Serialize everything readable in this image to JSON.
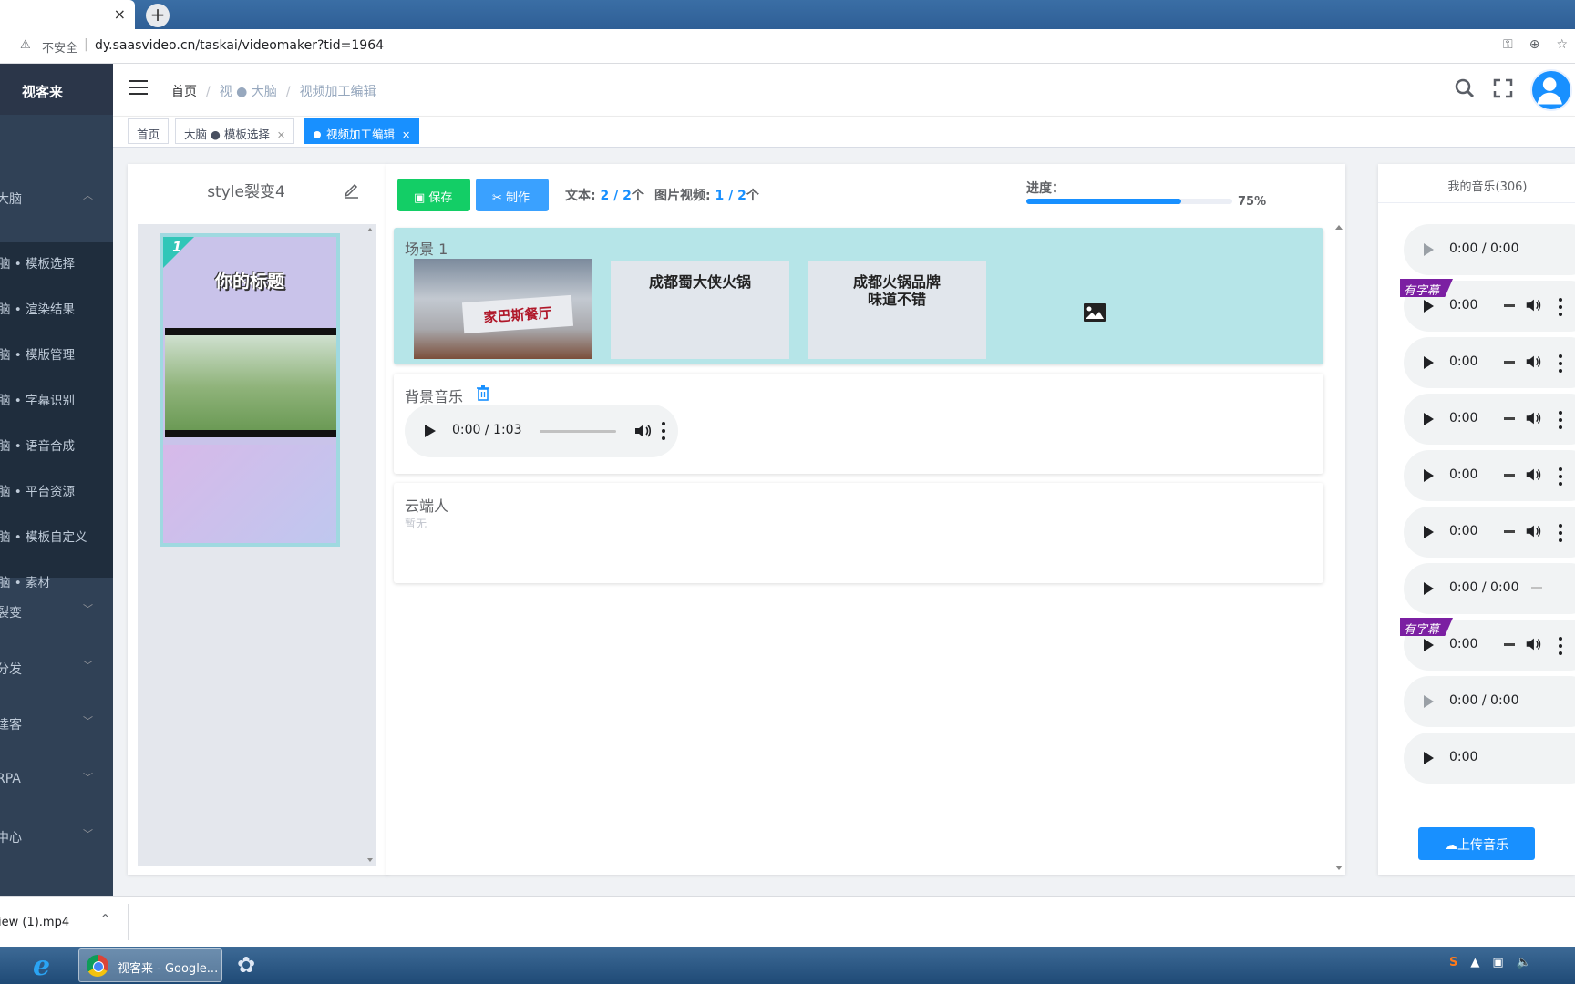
{
  "browser": {
    "tab_close": "×",
    "new_tab": "+",
    "security_label": "不安全",
    "url": "dy.saasvideo.cn/taskai/videomaker?tid=1964"
  },
  "sidebar": {
    "brand": "视客来",
    "groups": [
      {
        "label": "大脑"
      },
      {
        "label": "裂变"
      },
      {
        "label": "分发"
      },
      {
        "label": "達客"
      },
      {
        "label": "RPA"
      },
      {
        "label": "中心"
      }
    ],
    "sub_items": [
      {
        "label": "脑 • 模板选择"
      },
      {
        "label": "脑 • 渲染结果"
      },
      {
        "label": "脑 • 模版管理"
      },
      {
        "label": "脑 • 字幕识别"
      },
      {
        "label": "脑 • 语音合成"
      },
      {
        "label": "脑 • 平台资源"
      },
      {
        "label": "脑 • 模板自定义"
      },
      {
        "label": "脑 • 素材"
      }
    ]
  },
  "breadcrumb": {
    "home": "首页",
    "level1": "视 ● 大脑",
    "level2": "视频加工编辑"
  },
  "tags": {
    "home": "首页",
    "template_select": "大脑 ● 模板选择",
    "video_edit": "视频加工编辑"
  },
  "template": {
    "title": "style裂变4",
    "card_number": "1",
    "card_heading": "你的标题"
  },
  "toolbar": {
    "save_label": "保存",
    "make_label": "制作",
    "text_label": "文本:",
    "text_count": "2 / 2",
    "text_unit": "个",
    "media_label": "图片视频:",
    "media_count": "1 / 2",
    "media_unit": "个",
    "progress_label": "进度：",
    "progress_value": "75%",
    "progress_fraction": 0.75
  },
  "scene": {
    "title": "场景 1",
    "image_sign": "家巴斯餐厅",
    "text1": "成都蜀大侠火锅",
    "text2": "成都火锅品牌味道不错"
  },
  "bg_music": {
    "title": "背景音乐",
    "time": "0:00 / 1:03"
  },
  "cloud_person": {
    "title": "云端人",
    "empty": "暂无"
  },
  "music": {
    "title": "我的音乐(306)",
    "subtitle_badge": "有字幕",
    "upload_label": "上传音乐",
    "items": [
      {
        "time": "0:00 / 0:00"
      },
      {
        "time": "0:00"
      },
      {
        "time": "0:00"
      },
      {
        "time": "0:00"
      },
      {
        "time": "0:00"
      },
      {
        "time": "0:00"
      },
      {
        "time": "0:00 / 0:00"
      },
      {
        "time": "0:00"
      },
      {
        "time": "0:00 / 0:00"
      },
      {
        "time": "0:00"
      }
    ]
  },
  "download": {
    "file": "iew (1).mp4",
    "chevron": "^"
  },
  "taskbar": {
    "chrome_label": "视客来 - Google..."
  }
}
